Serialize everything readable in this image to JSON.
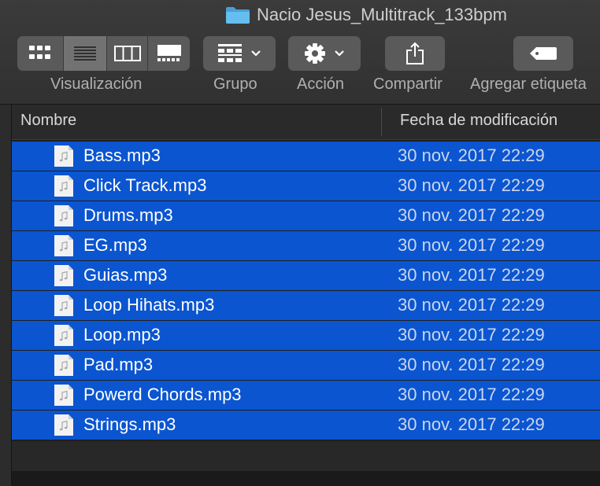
{
  "window": {
    "title": "Nacio Jesus_Multitrack_133bpm",
    "folder_icon": "folder-icon",
    "folder_color": "#58b2e8"
  },
  "toolbar": {
    "view": {
      "label": "Visualización",
      "modes": [
        "icon-view",
        "list-view",
        "column-view",
        "gallery-view"
      ],
      "selected": "list-view"
    },
    "group": {
      "label": "Grupo"
    },
    "action": {
      "label": "Acción"
    },
    "share": {
      "label": "Compartir"
    },
    "tags": {
      "label": "Agregar etiqueta"
    }
  },
  "list": {
    "columns": {
      "name": "Nombre",
      "date": "Fecha de modificación"
    },
    "selection_color": "#0b55d0",
    "files": [
      {
        "name": "Bass.mp3",
        "modified": "30 nov. 2017 22:29"
      },
      {
        "name": "Click Track.mp3",
        "modified": "30 nov. 2017 22:29"
      },
      {
        "name": "Drums.mp3",
        "modified": "30 nov. 2017 22:29"
      },
      {
        "name": "EG.mp3",
        "modified": "30 nov. 2017 22:29"
      },
      {
        "name": "Guias.mp3",
        "modified": "30 nov. 2017 22:29"
      },
      {
        "name": "Loop Hihats.mp3",
        "modified": "30 nov. 2017 22:29"
      },
      {
        "name": "Loop.mp3",
        "modified": "30 nov. 2017 22:29"
      },
      {
        "name": "Pad.mp3",
        "modified": "30 nov. 2017 22:29"
      },
      {
        "name": "Powerd Chords.mp3",
        "modified": "30 nov. 2017 22:29"
      },
      {
        "name": "Strings.mp3",
        "modified": "30 nov. 2017 22:29"
      }
    ]
  }
}
